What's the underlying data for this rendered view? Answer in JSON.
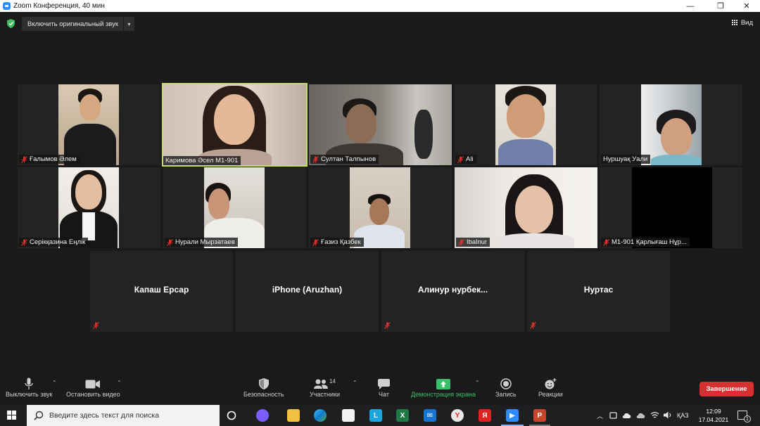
{
  "window": {
    "title": "Zoom Конференция, 40 мин",
    "minimize": "—",
    "restore": "❐",
    "close": "✕"
  },
  "topbar": {
    "original_audio_label": "Включить оригинальный звук",
    "caret": "▾",
    "view_label": "Вид"
  },
  "participants": [
    {
      "name": "Ғалымов Әлем",
      "muted": true
    },
    {
      "name": "Каримова Әсел М1-901",
      "muted": false,
      "active_speaker": true
    },
    {
      "name": "Султан Талпынов",
      "muted": true
    },
    {
      "name": "Ali",
      "muted": true
    },
    {
      "name": "Нуршуақ Уали",
      "muted": false
    },
    {
      "name": "Серікқазина Еңлік",
      "muted": true
    },
    {
      "name": "Нурали Мырзатаев",
      "muted": true
    },
    {
      "name": "Ғазиз Қазбек",
      "muted": true
    },
    {
      "name": "Ibalnur",
      "muted": true
    },
    {
      "name": "М1-901 Қарлығаш Нұр...",
      "muted": true
    },
    {
      "name": "Капаш Ерсар",
      "muted": true
    },
    {
      "name": "iPhone (Aruzhan)",
      "muted": false
    },
    {
      "name": "Алинур  нурбек...",
      "muted": true
    },
    {
      "name": "Нуртас",
      "muted": true
    }
  ],
  "toolbar": {
    "mute_label": "Выключить звук",
    "video_label": "Остановить видео",
    "security_label": "Безопасность",
    "participants_label": "Участники",
    "participants_count": "14",
    "chat_label": "Чат",
    "share_label": "Демонстрация экрана",
    "record_label": "Запись",
    "reactions_label": "Реакции",
    "end_label": "Завершение",
    "caret": "⌃"
  },
  "taskbar": {
    "search_placeholder": "Введите здесь текст для поиска",
    "lang": "ҚАЗ",
    "time": "12:09",
    "date": "17.04.2021",
    "notif_count": "1",
    "tray_chevron": "︿"
  },
  "colors": {
    "active_speaker_border": "#c4e05a",
    "end_button": "#d73030",
    "share_green": "#39c06b",
    "muted_red": "#e0302a"
  }
}
